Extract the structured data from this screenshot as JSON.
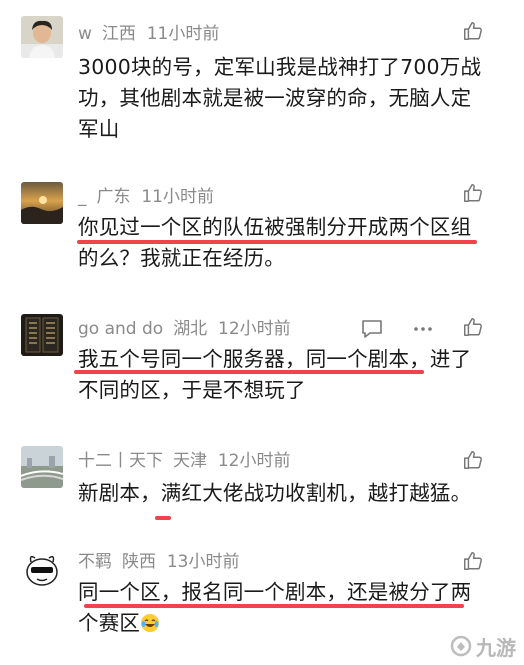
{
  "comments": [
    {
      "name": "w",
      "location": "江西",
      "time": "11小时前",
      "text": "3000块的号，定军山我是战神打了700万战功，其他剧本就是被一波穿的命，无脑人定军山",
      "avatar": "person-avatar"
    },
    {
      "name": "_",
      "location": "广东",
      "time": "11小时前",
      "text_line1": "你见过一个区的队伍被强制分开成两个区组",
      "text_line2": "的么？我就正在经历。",
      "avatar": "sunset-avatar"
    },
    {
      "name": "go and do",
      "location": "湖北",
      "time": "12小时前",
      "text_line1": "我五个号同一个服务器，同一个剧本，进了",
      "text_line2": "不同的区，于是不想玩了",
      "avatar": "book-avatar"
    },
    {
      "name": "十二丨天下",
      "location": "天津",
      "time": "12小时前",
      "text": "新剧本，满红大佬战功收割机，越打越猛。",
      "avatar": "city-avatar"
    },
    {
      "name": "不羁",
      "location": "陕西",
      "time": "13小时前",
      "text_line1": "同一个区，报名同一个剧本，还是被分了两",
      "text_line2": "个赛区",
      "avatar": "cartoon-avatar"
    }
  ],
  "watermark": "九游",
  "colors": {
    "highlight": "#f0434b",
    "meta": "#8a8a8a",
    "text": "#1a1a1a"
  }
}
